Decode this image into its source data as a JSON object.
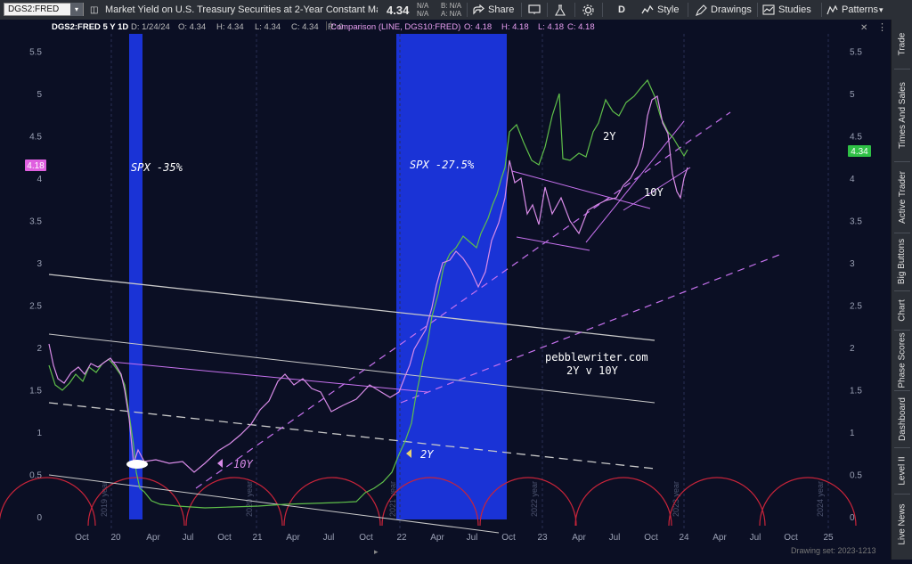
{
  "toolbar": {
    "symbol": "DGS2:FRED",
    "description": "Market Yield on U.S. Treasury Securities at 2-Year Constant Maturi...",
    "last": "4.34",
    "bid": "N/A",
    "ask": "N/A",
    "bid_label": "B:",
    "ask_label": "A:",
    "na1": "N/A",
    "na2": "N/A",
    "share": "Share",
    "aggregation": "D",
    "style": "Style",
    "drawings": "Drawings",
    "studies": "Studies",
    "patterns": "Patterns"
  },
  "info_bar": {
    "symbol": "DGS2:FRED 5 Y 1D",
    "date": "D: 1/24/24",
    "open": "O: 4.34",
    "high": "H: 4.34",
    "low": "L: 4.34",
    "close": "C: 4.34",
    "range": "R: 0",
    "comparison": "Comparison (LINE, DGS10:FRED)",
    "cmp_open": "O: 4.18",
    "cmp_high": "H: 4.18",
    "cmp_low": "L: 4.18",
    "cmp_close": "C: 4.18"
  },
  "annotations": {
    "spx1": "SPX -35%",
    "spx2": "SPX -27.5%",
    "y2": "2Y",
    "y10": "10Y",
    "arrow_10y": "10Y",
    "arrow_2y": "2Y",
    "site": "pebblewriter.com",
    "site_sub": "2Y v 10Y"
  },
  "badges": {
    "left": "4.18",
    "right": "4.34"
  },
  "y_axis": [
    "5.5",
    "5",
    "4.5",
    "4",
    "3.5",
    "3",
    "2.5",
    "2",
    "1.5",
    "1",
    "0.5",
    "0"
  ],
  "x_axis": [
    "Oct",
    "20",
    "Apr",
    "Jul",
    "Oct",
    "21",
    "Apr",
    "Jul",
    "Oct",
    "22",
    "Apr",
    "Jul",
    "Oct",
    "23",
    "Apr",
    "Jul",
    "Oct",
    "24",
    "Apr",
    "Jul",
    "Oct",
    "25"
  ],
  "year_labels": [
    "2019 year",
    "2020 year",
    "2021 year",
    "2022 year",
    "2023 year",
    "2024 year"
  ],
  "status": "Drawing set: 2023-1213",
  "sidebar": [
    "Trade",
    "Times And Sales",
    "Active Trader",
    "Big Buttons",
    "Chart",
    "Phase Scores",
    "Dashboard",
    "Level II",
    "Live News"
  ],
  "colors": {
    "dgs2": "#5fbf4a",
    "dgs10": "#d98ce8",
    "recession": "#1a33d6",
    "cycle": "#c8243a",
    "trend": "#c9c9c9",
    "dashed_trend": "#c772ef",
    "badge_left": "#e060e0",
    "badge_right": "#2fc046"
  }
}
